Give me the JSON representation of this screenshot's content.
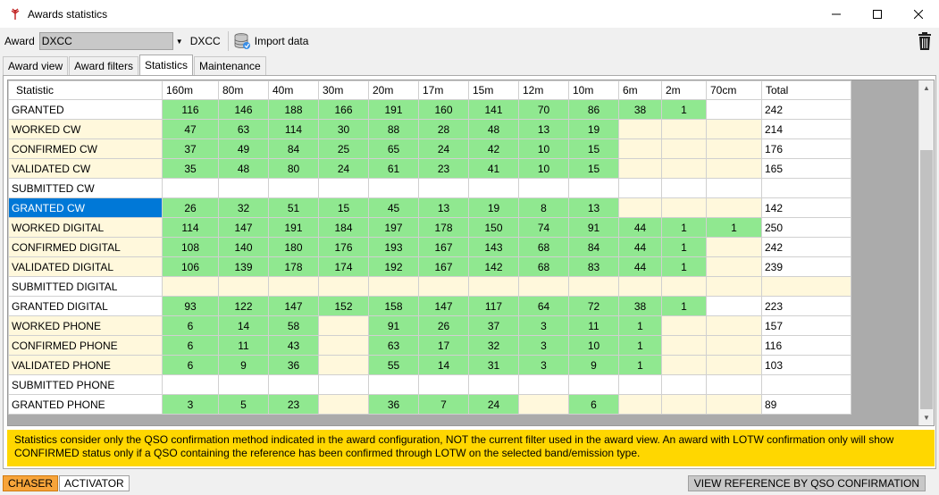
{
  "window": {
    "title": "Awards statistics"
  },
  "toolbar": {
    "award_label": "Award",
    "award_value": "DXCC",
    "award_name": "DXCC",
    "import_label": "Import data"
  },
  "tabs": [
    "Award view",
    "Award filters",
    "Statistics",
    "Maintenance"
  ],
  "table": {
    "headers": [
      "Statistic",
      "160m",
      "80m",
      "40m",
      "30m",
      "20m",
      "17m",
      "15m",
      "12m",
      "10m",
      "6m",
      "2m",
      "70cm",
      "Total"
    ],
    "rows": [
      {
        "label": "GRANTED",
        "values": [
          "116",
          "146",
          "188",
          "166",
          "191",
          "160",
          "141",
          "70",
          "86",
          "38",
          "1",
          ""
        ],
        "total": "242"
      },
      {
        "label": "WORKED CW",
        "values": [
          "47",
          "63",
          "114",
          "30",
          "88",
          "28",
          "48",
          "13",
          "19",
          "",
          "",
          ""
        ],
        "total": "214"
      },
      {
        "label": "CONFIRMED CW",
        "values": [
          "37",
          "49",
          "84",
          "25",
          "65",
          "24",
          "42",
          "10",
          "15",
          "",
          "",
          ""
        ],
        "total": "176"
      },
      {
        "label": "VALIDATED CW",
        "values": [
          "35",
          "48",
          "80",
          "24",
          "61",
          "23",
          "41",
          "10",
          "15",
          "",
          "",
          ""
        ],
        "total": "165"
      },
      {
        "label": "SUBMITTED CW",
        "values": [
          "",
          "",
          "",
          "",
          "",
          "",
          "",
          "",
          "",
          "",
          "",
          ""
        ],
        "total": ""
      },
      {
        "label": "GRANTED CW",
        "values": [
          "26",
          "32",
          "51",
          "15",
          "45",
          "13",
          "19",
          "8",
          "13",
          "",
          "",
          ""
        ],
        "total": "142"
      },
      {
        "label": "WORKED DIGITAL",
        "values": [
          "114",
          "147",
          "191",
          "184",
          "197",
          "178",
          "150",
          "74",
          "91",
          "44",
          "1",
          "1"
        ],
        "total": "250"
      },
      {
        "label": "CONFIRMED DIGITAL",
        "values": [
          "108",
          "140",
          "180",
          "176",
          "193",
          "167",
          "143",
          "68",
          "84",
          "44",
          "1",
          ""
        ],
        "total": "242"
      },
      {
        "label": "VALIDATED DIGITAL",
        "values": [
          "106",
          "139",
          "178",
          "174",
          "192",
          "167",
          "142",
          "68",
          "83",
          "44",
          "1",
          ""
        ],
        "total": "239"
      },
      {
        "label": "SUBMITTED DIGITAL",
        "values": [
          "",
          "",
          "",
          "",
          "",
          "",
          "",
          "",
          "",
          "",
          "",
          ""
        ],
        "total": ""
      },
      {
        "label": "GRANTED DIGITAL",
        "values": [
          "93",
          "122",
          "147",
          "152",
          "158",
          "147",
          "117",
          "64",
          "72",
          "38",
          "1",
          ""
        ],
        "total": "223"
      },
      {
        "label": "WORKED PHONE",
        "values": [
          "6",
          "14",
          "58",
          "",
          "91",
          "26",
          "37",
          "3",
          "11",
          "1",
          "",
          ""
        ],
        "total": "157"
      },
      {
        "label": "CONFIRMED PHONE",
        "values": [
          "6",
          "11",
          "43",
          "",
          "63",
          "17",
          "32",
          "3",
          "10",
          "1",
          "",
          ""
        ],
        "total": "116"
      },
      {
        "label": "VALIDATED PHONE",
        "values": [
          "6",
          "9",
          "36",
          "",
          "55",
          "14",
          "31",
          "3",
          "9",
          "1",
          "",
          ""
        ],
        "total": "103"
      },
      {
        "label": "SUBMITTED PHONE",
        "values": [
          "",
          "",
          "",
          "",
          "",
          "",
          "",
          "",
          "",
          "",
          "",
          ""
        ],
        "total": ""
      },
      {
        "label": "GRANTED PHONE",
        "values": [
          "3",
          "5",
          "23",
          "",
          "36",
          "7",
          "24",
          "",
          "6",
          "",
          "",
          ""
        ],
        "total": "89"
      }
    ]
  },
  "info_text": "Statistics consider only the QSO confirmation method indicated in the award configuration, NOT the current filter used in the award view. An award with LOTW confirmation only will show CONFIRMED status only if a QSO containing the reference has been confirmed through LOTW on the selected band/emission type.",
  "bottom_tabs": [
    "CHASER",
    "ACTIVATOR"
  ],
  "view_ref_label": "VIEW REFERENCE BY QSO CONFIRMATION",
  "colors": {
    "granted": "#90e890",
    "pending": "#fff8dc",
    "selected": "#0078d7",
    "info": "#ffd700",
    "chaser": "#f7a43a"
  },
  "icons": {
    "app": "antenna-icon",
    "import": "database-icon",
    "delete": "trash-icon"
  }
}
